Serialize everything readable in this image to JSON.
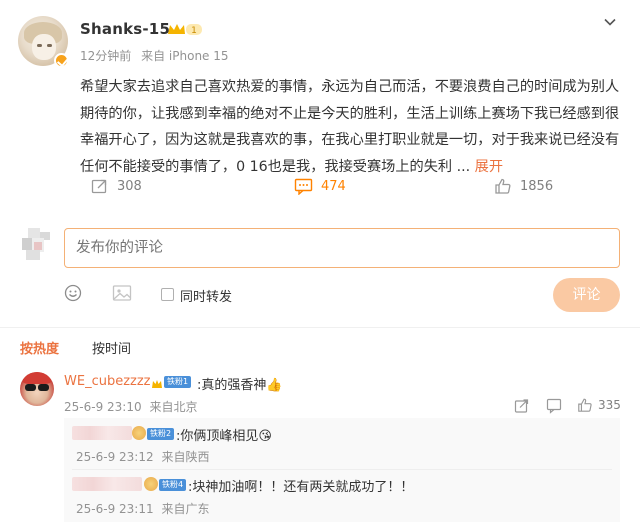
{
  "post": {
    "username": "Shanks-15",
    "level_badge": "1",
    "time": "12分钟前",
    "source": "来自 iPhone 15",
    "text": "希望大家去追求自己喜欢热爱的事情，永远为自己而活，不要浪费自己的时间成为别人期待的你，让我感到幸福的绝对不止是今天的胜利，生活上训练上赛场下我已经感到很幸福开心了，因为这就是我喜欢的事，在我心里打职业就是一切，对于我来说已经没有任何不能接受的事情了，0 16也是我，我接受赛场上的失利 ...",
    "more": "展开",
    "reposts": "308",
    "comments": "474",
    "likes": "1856"
  },
  "composer": {
    "placeholder": "发布你的评论",
    "repost_label": "同时转发",
    "submit_label": "评论"
  },
  "sort": {
    "hot": "按热度",
    "time": "按时间"
  },
  "comment": {
    "username": "WE_cubezzzz",
    "fan_badge": "铁粉1",
    "text": ":真的强香神",
    "time": "25-6-9 23:10",
    "source": "来自北京",
    "likes": "335"
  },
  "replies": [
    {
      "fan_badge": "铁粉2",
      "text": ":你俩顶峰相见",
      "time": "25-6-9 23:12",
      "source": "来自陕西"
    },
    {
      "fan_badge": "铁粉4",
      "text": ":块神加油啊！！还有两关就成功了！！",
      "time": "25-6-9 23:11",
      "source": "来自广东"
    }
  ],
  "colors": {
    "accent_orange": "#ff8200",
    "link_orange": "#eb7340",
    "input_border": "#f4b176",
    "submit_bg": "#fac9a3",
    "meta_gray": "#939393"
  }
}
